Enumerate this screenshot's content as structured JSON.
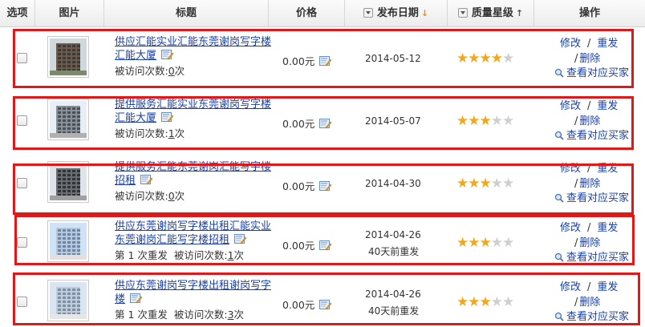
{
  "columns": {
    "select": "选项",
    "image": "图片",
    "title": "标题",
    "price": "价格",
    "date": "发布日期",
    "quality": "质量星级",
    "actions": "操作"
  },
  "actions": {
    "edit": "修改",
    "repost": "重发",
    "delete": "删除",
    "view_buyers": "查看对应买家",
    "separator": "/"
  },
  "rows": [
    {
      "title_line1": "供应汇能实业汇能东莞谢岗写字楼",
      "title_line2": "汇能大厦",
      "repost_count": "",
      "visits_label": "被访问次数:",
      "visits_value": "0",
      "visits_unit": "次",
      "price": "0.00元",
      "date": "2014-05-12",
      "repub_note": "",
      "stars": 4
    },
    {
      "title_line1": "提供服务汇能实业东莞谢岗写字楼",
      "title_line2": "汇能大厦",
      "repost_count": "",
      "visits_label": "被访问次数:",
      "visits_value": "1",
      "visits_unit": "次",
      "price": "0.00元",
      "date": "2014-05-07",
      "repub_note": "",
      "stars": 3
    },
    {
      "title_line1": "提供服务汇能东莞谢岗汇能写字楼",
      "title_line2": "招租",
      "repost_count": "",
      "visits_label": "被访问次数:",
      "visits_value": "0",
      "visits_unit": "次",
      "price": "0.00元",
      "date": "2014-04-30",
      "repub_note": "",
      "stars": 3
    },
    {
      "title_line1": "供应东莞谢岗写字楼出租汇能实业",
      "title_line2": "东莞谢岗汇能写字楼招租",
      "repost_count": "第 1 次重发",
      "visits_label": "被访问次数:",
      "visits_value": "1",
      "visits_unit": "次",
      "price": "0.00元",
      "date": "2014-04-26",
      "repub_note": "40天前重发",
      "stars": 3
    },
    {
      "title_line1": "供应东莞谢岗写字楼出租谢岗写字",
      "title_line2": "楼",
      "repost_count": "第 1 次重发",
      "visits_label": "被访问次数:",
      "visits_value": "3",
      "visits_unit": "次",
      "price": "0.00元",
      "date": "2014-04-26",
      "repub_note": "40天前重发",
      "stars": 3
    }
  ],
  "colors": {
    "link": "#1a3fa5",
    "highlight_border": "#e01818",
    "star_on": "#f3a81b",
    "star_off": "#cfcfcf",
    "sort_active": "#f08a1a"
  }
}
